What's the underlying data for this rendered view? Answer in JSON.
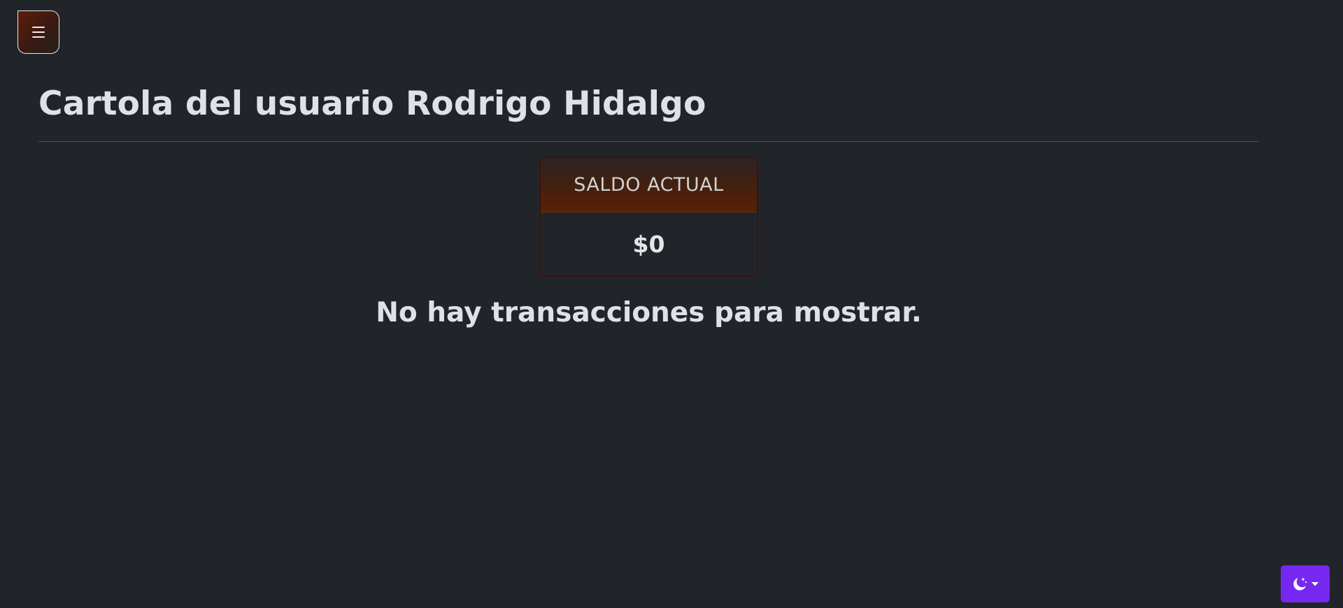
{
  "nav": {
    "menu_icon": "hamburger-icon"
  },
  "page": {
    "title": "Cartola del usuario Rodrigo Hidalgo"
  },
  "balance": {
    "label": "SALDO ACTUAL",
    "value": "$0"
  },
  "transactions": {
    "empty_message": "No hay transacciones para mostrar."
  },
  "theme": {
    "icon": "moon-stars-icon",
    "dropdown_icon": "caret-down-icon",
    "accent_color": "#7628f0"
  },
  "colors": {
    "background": "#212529",
    "text": "#dee2e6",
    "card_header_accent": "#5a2008"
  }
}
